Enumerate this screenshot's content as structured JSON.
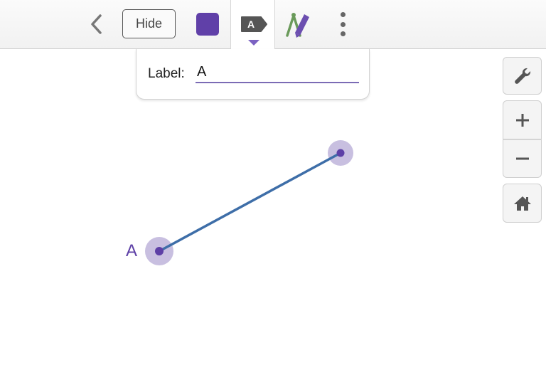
{
  "toolbar": {
    "hide_label": "Hide",
    "label_tag_text": "A",
    "point_color": "#6040a8",
    "icons": {
      "back": "chevron-left-icon",
      "label": "label-tag-icon",
      "tools": "compass-ruler-icon",
      "more": "more-vertical-icon"
    }
  },
  "label_popup": {
    "label_text": "Label:",
    "input_value": "A"
  },
  "side_controls": {
    "icons": [
      "wrench-icon",
      "plus-icon",
      "minus-icon",
      "home-icon"
    ]
  },
  "canvas": {
    "point_label": "A",
    "segment_color": "#3e6ea8",
    "point_color": "#5d3fa6",
    "highlight_color": "#c8bfe0"
  }
}
